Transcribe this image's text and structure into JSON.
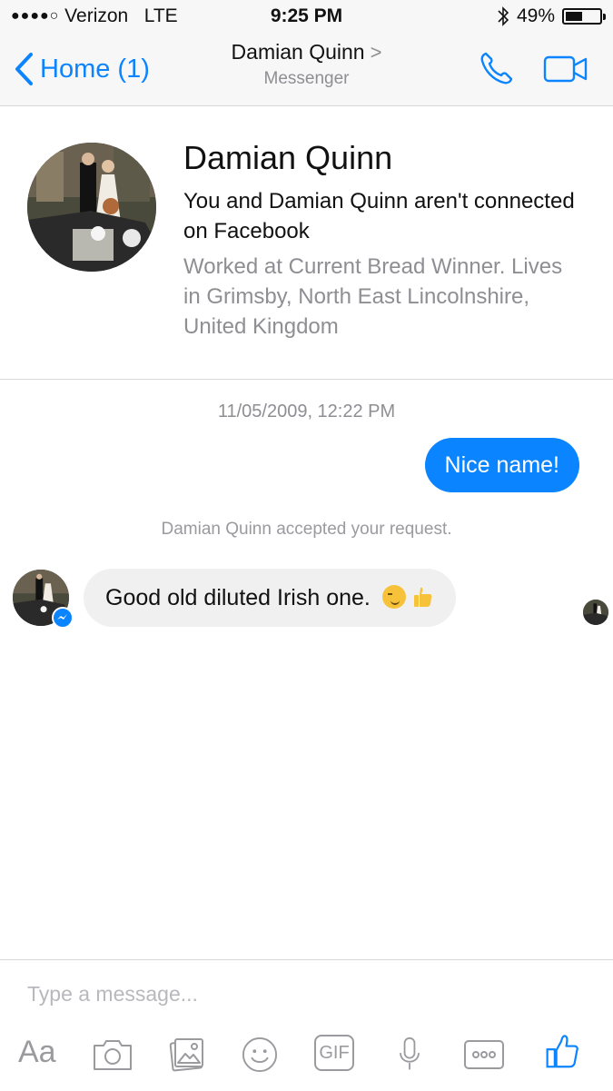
{
  "status_bar": {
    "signal": "●●●●○",
    "carrier": "Verizon",
    "network": "LTE",
    "time": "9:25 PM",
    "battery_text": "49%",
    "battery_level": 0.49
  },
  "nav": {
    "back_label": "Home (1)",
    "title": "Damian Quinn",
    "title_chevron": ">",
    "subtitle": "Messenger"
  },
  "profile": {
    "name": "Damian Quinn",
    "connection": "You and Damian Quinn aren't connected on Facebook",
    "info": "Worked at Current Bread Winner. Lives in Grimsby, North East Lincolnshire, United Kingdom"
  },
  "conversation": {
    "timestamp": "11/05/2009, 12:22 PM",
    "outgoing_message": "Nice name!",
    "system_message": "Damian Quinn accepted your request.",
    "incoming_message": "Good old diluted Irish one."
  },
  "composer": {
    "placeholder": "Type a message...",
    "aa_label": "Aa",
    "gif_label": "GIF",
    "tools": [
      "aa-icon",
      "camera-icon",
      "photo-gallery-icon",
      "emoji-icon",
      "gif-icon",
      "microphone-icon",
      "more-icon",
      "thumbs-up-icon"
    ]
  },
  "colors": {
    "accent": "#0a84ff",
    "bubble_in": "#f1f0f0",
    "secondary_text": "#8e8e93"
  }
}
